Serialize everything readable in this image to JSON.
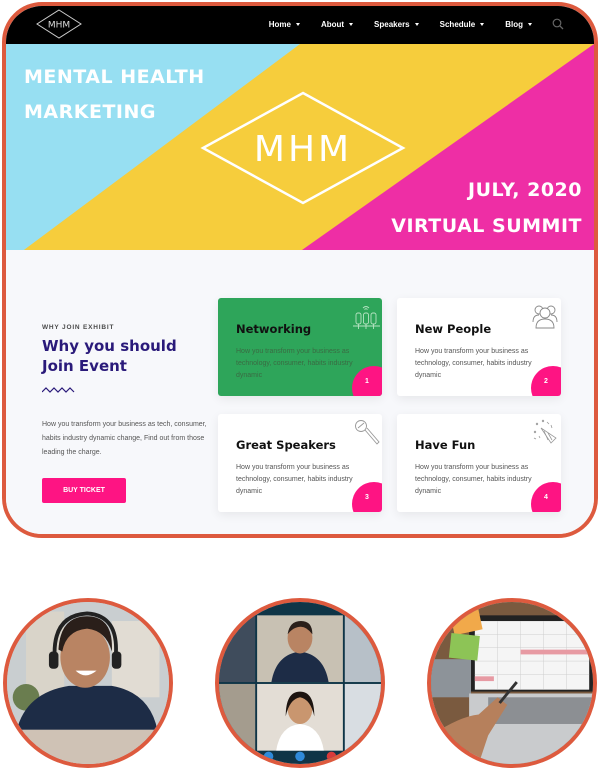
{
  "nav": {
    "logo_text": "MHM",
    "items": [
      {
        "label": "Home"
      },
      {
        "label": "About"
      },
      {
        "label": "Speakers"
      },
      {
        "label": "Schedule"
      },
      {
        "label": "Blog"
      }
    ],
    "search_icon": "search-icon"
  },
  "hero": {
    "title_line1": "MENTAL HEALTH",
    "title_line2": "MARKETING",
    "logo_text": "MHM",
    "date_line": "JULY, 2020",
    "event_line": "VIRTUAL SUMMIT",
    "colors": {
      "blue": "#97dff2",
      "yellow": "#f6cd3c",
      "magenta": "#ee2ea5"
    }
  },
  "section": {
    "eyebrow": "WHY JOIN EXHIBIT",
    "title_line1": "Why you should",
    "title_line2": "Join Event",
    "description": "How you transform your business as tech, consumer, habits industry dynamic change, Find out from those leading the charge.",
    "button_label": "BUY TICKET"
  },
  "cards": [
    {
      "title": "Networking",
      "description": "How you transform your business as technology, consumer, habits industry dynamic",
      "number": "1",
      "icon": "network-devices-icon"
    },
    {
      "title": "New People",
      "description": "How you transform your business as technology, consumer, habits industry dynamic",
      "number": "2",
      "icon": "people-group-icon"
    },
    {
      "title": "Great Speakers",
      "description": "How you transform your business as technology, consumer, habits industry dynamic",
      "number": "3",
      "icon": "microphone-icon"
    },
    {
      "title": "Have Fun",
      "description": "How you transform your business as technology, consumer, habits industry dynamic",
      "number": "4",
      "icon": "party-popper-icon"
    }
  ],
  "photos": [
    {
      "subject": "woman-with-headset-laughing"
    },
    {
      "subject": "video-conference-grid"
    },
    {
      "subject": "calendar-on-laptop"
    }
  ],
  "colors": {
    "frame_border": "#dd5a3e",
    "accent_pink": "#fe1483",
    "title_purple": "#2a1a7a",
    "card_green": "#2ea55a"
  }
}
